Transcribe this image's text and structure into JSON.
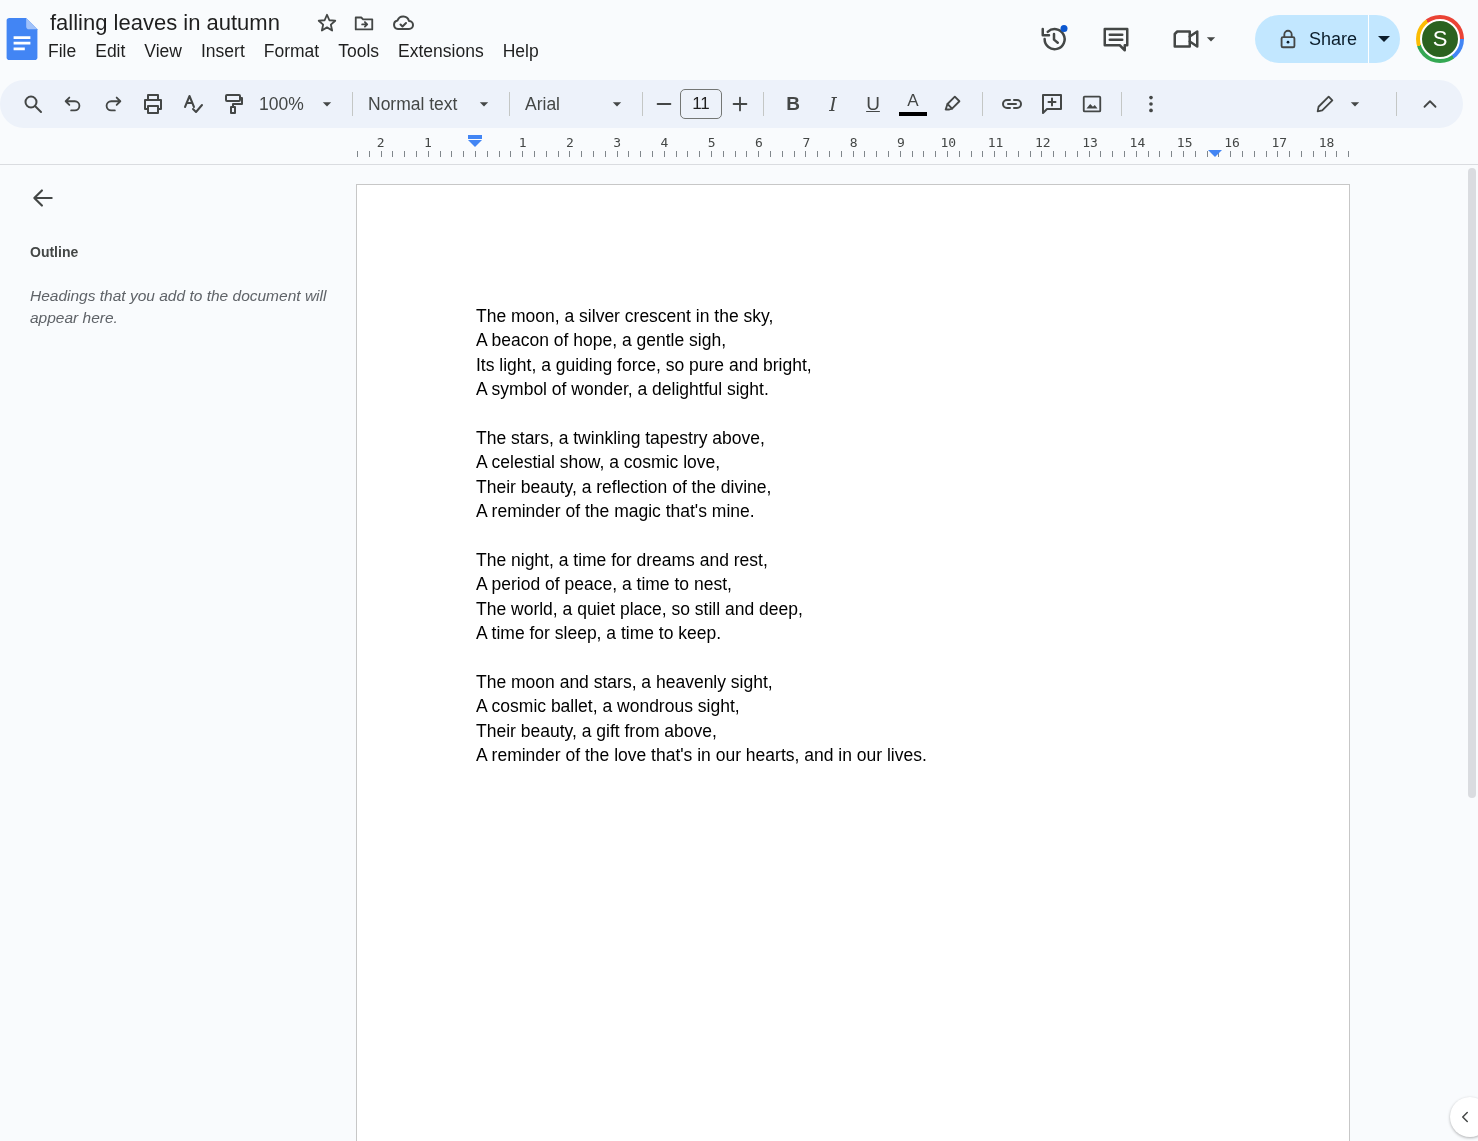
{
  "document": {
    "title": "falling leaves in autumn"
  },
  "menus": [
    "File",
    "Edit",
    "View",
    "Insert",
    "Format",
    "Tools",
    "Extensions",
    "Help"
  ],
  "share": {
    "label": "Share"
  },
  "avatar": {
    "letter": "S"
  },
  "toolbar": {
    "zoom": "100%",
    "style": "Normal text",
    "font": "Arial",
    "font_size": "11",
    "bold": "B",
    "italic": "I",
    "underline": "U",
    "text_color": "A"
  },
  "ruler": {
    "labels": [
      "2",
      "1",
      "1",
      "2",
      "3",
      "4",
      "5",
      "6",
      "7",
      "8",
      "9",
      "10",
      "11",
      "12",
      "13",
      "14",
      "15",
      "16",
      "17",
      "18"
    ]
  },
  "outline": {
    "heading": "Outline",
    "hint": "Headings that you add to the document will appear here."
  },
  "poem": [
    [
      "The moon, a silver crescent in the sky,",
      "A beacon of hope, a gentle sigh,",
      "Its light, a guiding force, so pure and bright,",
      "A symbol of wonder, a delightful sight."
    ],
    [
      "The stars, a twinkling tapestry above,",
      "A celestial show, a cosmic love,",
      "Their beauty, a reflection of the divine,",
      "A reminder of the magic that's mine."
    ],
    [
      "The night, a time for dreams and rest,",
      "A period of peace, a time to nest,",
      "The world, a quiet place, so still and deep,",
      "A time for sleep, a time to keep."
    ],
    [
      "The moon and stars, a heavenly sight,",
      "A cosmic ballet, a wondrous sight,",
      "Their beauty, a gift from above,",
      "A reminder of the love that's in our hearts, and in our lives."
    ]
  ]
}
